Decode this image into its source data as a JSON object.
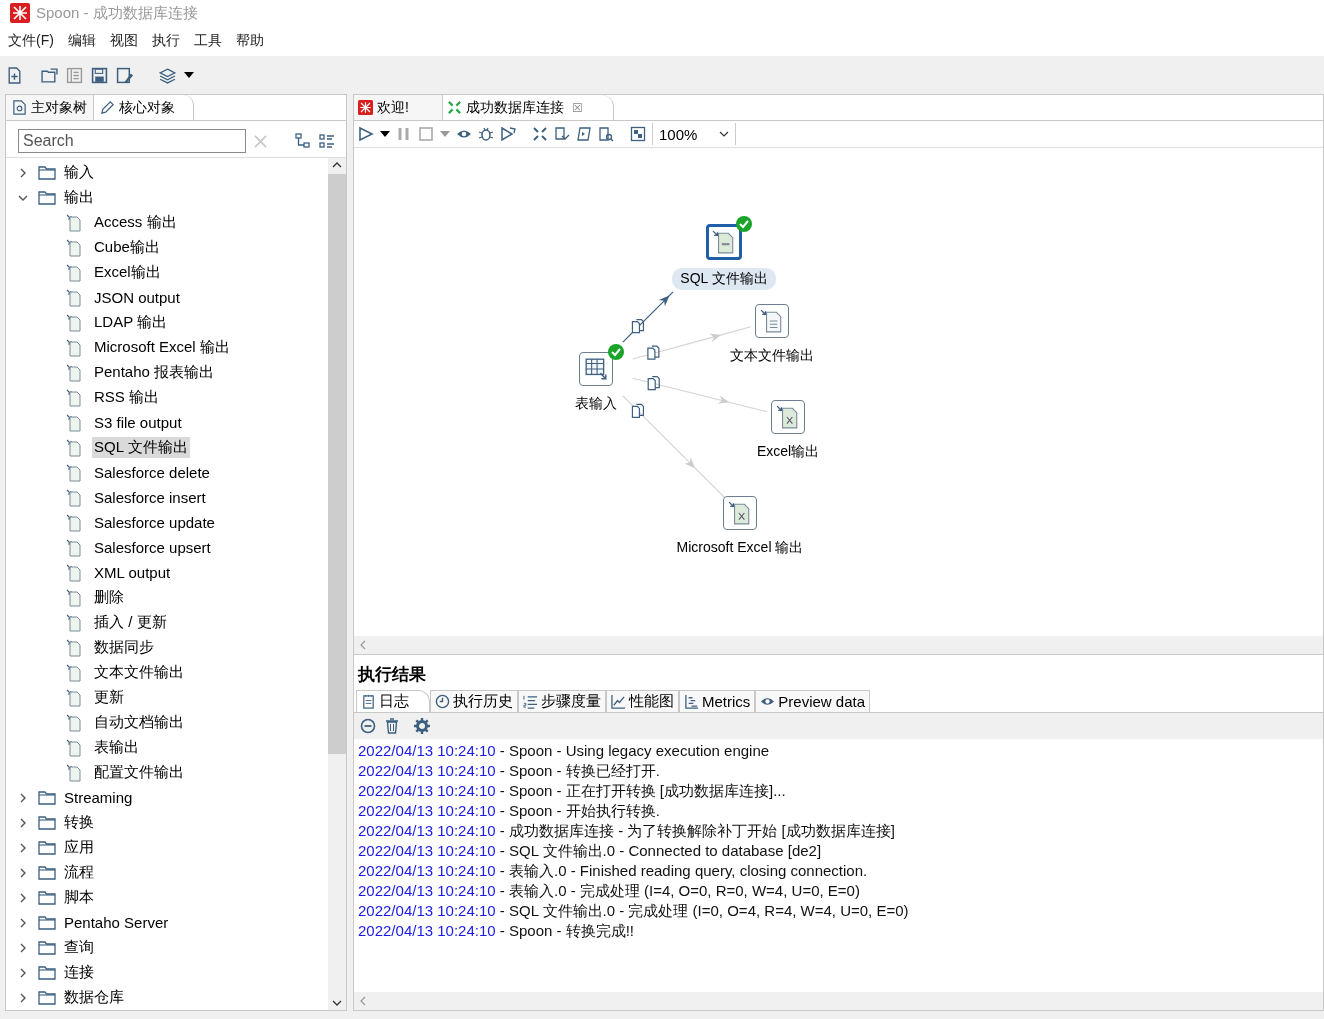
{
  "window": {
    "title": "Spoon - 成功数据库连接"
  },
  "menu": [
    "文件(F)",
    "编辑",
    "视图",
    "执行",
    "工具",
    "帮助"
  ],
  "left_tabs": [
    {
      "label": "主对象树",
      "selected": false,
      "kind": "tree"
    },
    {
      "label": "核心对象",
      "selected": true,
      "kind": "pencil"
    }
  ],
  "search": {
    "placeholder": "Search"
  },
  "tree": [
    {
      "label": "输入",
      "expanded": false
    },
    {
      "label": "输出",
      "expanded": true,
      "children": [
        {
          "label": "Access 输出",
          "selected": false
        },
        {
          "label": "Cube输出",
          "selected": false
        },
        {
          "label": "Excel输出",
          "selected": false
        },
        {
          "label": "JSON output",
          "selected": false
        },
        {
          "label": "LDAP 输出",
          "selected": false
        },
        {
          "label": "Microsoft Excel 输出",
          "selected": false
        },
        {
          "label": "Pentaho 报表输出",
          "selected": false
        },
        {
          "label": "RSS 输出",
          "selected": false
        },
        {
          "label": "S3 file output",
          "selected": false
        },
        {
          "label": "SQL 文件输出",
          "selected": true
        },
        {
          "label": "Salesforce delete",
          "selected": false
        },
        {
          "label": "Salesforce insert",
          "selected": false
        },
        {
          "label": "Salesforce update",
          "selected": false
        },
        {
          "label": "Salesforce upsert",
          "selected": false
        },
        {
          "label": "XML output",
          "selected": false
        },
        {
          "label": "删除",
          "selected": false
        },
        {
          "label": "插入 / 更新",
          "selected": false
        },
        {
          "label": "数据同步",
          "selected": false
        },
        {
          "label": "文本文件输出",
          "selected": false
        },
        {
          "label": "更新",
          "selected": false
        },
        {
          "label": "自动文档输出",
          "selected": false
        },
        {
          "label": "表输出",
          "selected": false
        },
        {
          "label": "配置文件输出",
          "selected": false
        }
      ]
    },
    {
      "label": "Streaming",
      "expanded": false
    },
    {
      "label": "转换",
      "expanded": false
    },
    {
      "label": "应用",
      "expanded": false
    },
    {
      "label": "流程",
      "expanded": false
    },
    {
      "label": "脚本",
      "expanded": false
    },
    {
      "label": "Pentaho Server",
      "expanded": false
    },
    {
      "label": "查询",
      "expanded": false
    },
    {
      "label": "连接",
      "expanded": false
    },
    {
      "label": "数据仓库",
      "expanded": false
    }
  ],
  "editor_tabs": [
    {
      "label": "欢迎!",
      "selected": false,
      "kind": "welcome"
    },
    {
      "label": "成功数据库连接",
      "selected": true,
      "kind": "transformation",
      "close": "☒"
    }
  ],
  "zoom": "100%",
  "canvas": {
    "nodes": [
      {
        "label": "表输入",
        "kind": "table",
        "selected": false,
        "ok": true
      },
      {
        "label": "SQL 文件输出",
        "kind": "sql",
        "selected": true,
        "ok": true
      },
      {
        "label": "文本文件输出",
        "kind": "text",
        "selected": false,
        "ok": false
      },
      {
        "label": "Excel输出",
        "kind": "excel",
        "selected": false,
        "ok": false
      },
      {
        "label": "Microsoft Excel 输出",
        "kind": "excel",
        "selected": false,
        "ok": false
      }
    ],
    "hops": [
      {
        "enabled": true
      },
      {
        "enabled": false
      },
      {
        "enabled": false
      },
      {
        "enabled": false
      }
    ]
  },
  "results": {
    "title": "执行结果",
    "tabs": [
      {
        "label": "日志",
        "selected": true,
        "kind": "log"
      },
      {
        "label": "执行历史",
        "selected": false,
        "kind": "history"
      },
      {
        "label": "步骤度量",
        "selected": false,
        "kind": "steps"
      },
      {
        "label": "性能图",
        "selected": false,
        "kind": "perf"
      },
      {
        "label": "Metrics",
        "selected": false,
        "kind": "metrics"
      },
      {
        "label": "Preview data",
        "selected": false,
        "kind": "preview"
      }
    ],
    "log": [
      {
        "time": "2022/04/13 10:24:10",
        "message": " - Spoon - Using legacy execution engine"
      },
      {
        "time": "2022/04/13 10:24:10",
        "message": " - Spoon - 转换已经打开."
      },
      {
        "time": "2022/04/13 10:24:10",
        "message": " - Spoon - 正在打开转换 [成功数据库连接]..."
      },
      {
        "time": "2022/04/13 10:24:10",
        "message": " - Spoon - 开始执行转换."
      },
      {
        "time": "2022/04/13 10:24:10",
        "message": " - 成功数据库连接 - 为了转换解除补丁开始  [成功数据库连接]"
      },
      {
        "time": "2022/04/13 10:24:10",
        "message": " - SQL 文件输出.0 - Connected to database [de2]"
      },
      {
        "time": "2022/04/13 10:24:10",
        "message": " - 表输入.0 - Finished reading query, closing connection."
      },
      {
        "time": "2022/04/13 10:24:10",
        "message": " - 表输入.0 - 完成处理 (I=4, O=0, R=0, W=4, U=0, E=0)"
      },
      {
        "time": "2022/04/13 10:24:10",
        "message": " - SQL 文件输出.0 - 完成处理 (I=0, O=4, R=4, W=4, U=0, E=0)"
      },
      {
        "time": "2022/04/13 10:24:10",
        "message": " - Spoon - 转换完成!!"
      }
    ]
  }
}
